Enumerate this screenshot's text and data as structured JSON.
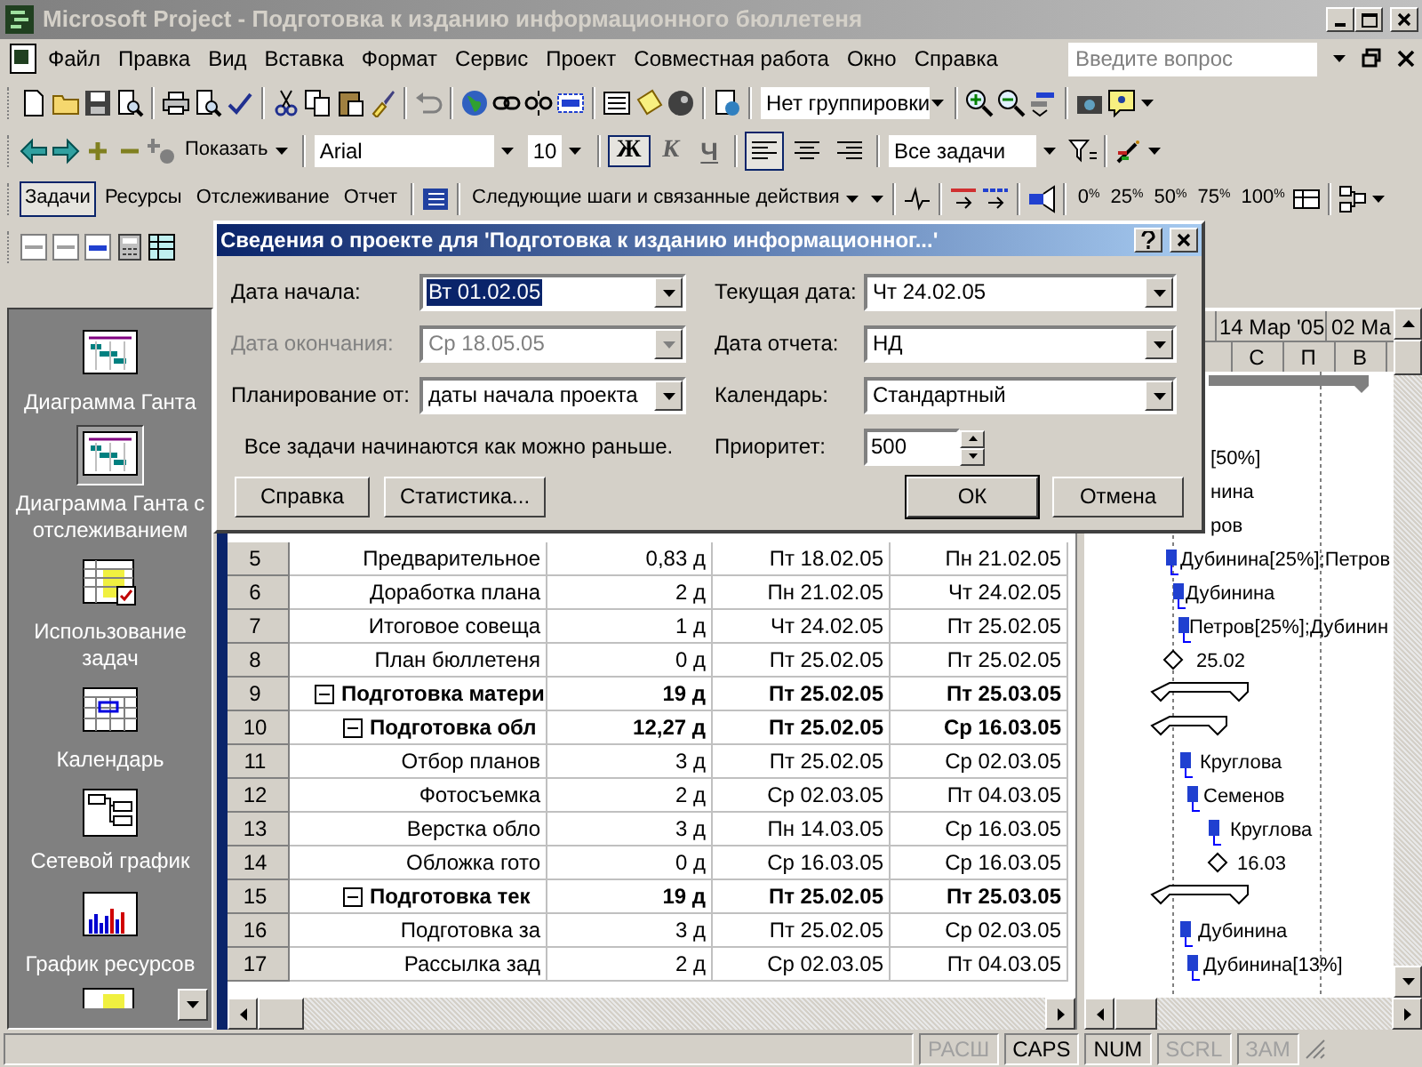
{
  "window": {
    "title": "Microsoft Project - Подготовка к изданию информационного бюллетеня"
  },
  "menu": [
    "Файл",
    "Правка",
    "Вид",
    "Вставка",
    "Формат",
    "Сервис",
    "Проект",
    "Совместная работа",
    "Окно",
    "Справка"
  ],
  "help_box": {
    "placeholder": "Введите вопрос"
  },
  "standard_toolbar": {
    "grouping": "Нет группировки"
  },
  "formatting_toolbar": {
    "show": "Показать",
    "font": "Arial",
    "size": "10",
    "styles": [
      {
        "label": "Ж",
        "on": true
      },
      {
        "label": "К",
        "on": false
      },
      {
        "label": "Ч",
        "on": false
      }
    ],
    "align": [
      {
        "selected": true
      },
      {
        "selected": false
      },
      {
        "selected": false
      }
    ],
    "filter": "Все задачи"
  },
  "guide_toolbar": {
    "tabs": [
      {
        "label": "Задачи",
        "selected": true
      },
      {
        "label": "Ресурсы",
        "selected": false
      },
      {
        "label": "Отслеживание",
        "selected": false
      },
      {
        "label": "Отчет",
        "selected": false
      }
    ],
    "next_steps": "Следующие шаги и связанные действия",
    "percent_buttons": [
      "0$^{%}$",
      "25$^{%}$",
      "50$^{%}$",
      "75$^{%}$",
      "100$^{%}$"
    ]
  },
  "view_bar": {
    "items": [
      {
        "label": "Диаграмма Ганта",
        "kind": "gantt",
        "selected": false
      },
      {
        "label": "Диаграмма Ганта с отслеживанием",
        "kind": "gantt",
        "selected": true
      },
      {
        "label": "Использование задач",
        "kind": "usage",
        "selected": false
      },
      {
        "label": "Календарь",
        "kind": "calendar",
        "selected": false
      },
      {
        "label": "Сетевой график",
        "kind": "network",
        "selected": false
      },
      {
        "label": "График ресурсов",
        "kind": "graph",
        "selected": false
      }
    ]
  },
  "table": {
    "rows": [
      {
        "id": "5",
        "name": "Предварительное",
        "duration": "0,83 д",
        "start": "Пт 18.02.05",
        "finish": "Пн 21.02.05",
        "summary": false
      },
      {
        "id": "6",
        "name": "Доработка плана",
        "duration": "2 д",
        "start": "Пн 21.02.05",
        "finish": "Чт 24.02.05",
        "summary": false
      },
      {
        "id": "7",
        "name": "Итоговое совеща",
        "duration": "1 д",
        "start": "Чт 24.02.05",
        "finish": "Пт 25.02.05",
        "summary": false
      },
      {
        "id": "8",
        "name": "План бюллетеня",
        "duration": "0 д",
        "start": "Пт 25.02.05",
        "finish": "Пт 25.02.05",
        "summary": false
      },
      {
        "id": "9",
        "name": "Подготовка матери",
        "duration": "19 д",
        "start": "Пт 25.02.05",
        "finish": "Пт 25.03.05",
        "summary": true,
        "expanded": true,
        "children": [
          {
            "id": "10",
            "name": "Подготовка обл",
            "duration": "12,27 д",
            "start": "Пт 25.02.05",
            "finish": "Ср 16.03.05",
            "summary": true,
            "expanded": true,
            "children": [
              {
                "id": "11",
                "name": "Отбор планов",
                "duration": "3 д",
                "start": "Пт 25.02.05",
                "finish": "Ср 02.03.05",
                "summary": false
              },
              {
                "id": "12",
                "name": "Фотосъемка",
                "duration": "2 д",
                "start": "Ср 02.03.05",
                "finish": "Пт 04.03.05",
                "summary": false
              },
              {
                "id": "13",
                "name": "Верстка обло",
                "duration": "3 д",
                "start": "Пн 14.03.05",
                "finish": "Ср 16.03.05",
                "summary": false
              },
              {
                "id": "14",
                "name": "Обложка гото",
                "duration": "0 д",
                "start": "Ср 16.03.05",
                "finish": "Ср 16.03.05",
                "summary": false
              }
            ]
          },
          {
            "id": "15",
            "name": "Подготовка тек",
            "duration": "19 д",
            "start": "Пт 25.02.05",
            "finish": "Пт 25.03.05",
            "summary": true,
            "expanded": true,
            "children": [
              {
                "id": "16",
                "name": "Подготовка за",
                "duration": "3 д",
                "start": "Пт 25.02.05",
                "finish": "Ср 02.03.05",
                "summary": false
              },
              {
                "id": "17",
                "name": "Рассылка зад",
                "duration": "2 д",
                "start": "Ср 02.03.05",
                "finish": "Пт 04.03.05",
                "summary": false
              }
            ]
          }
        ]
      }
    ]
  },
  "gantt": {
    "timescale_top": [
      "14 Мар '05",
      "02 Ма"
    ],
    "timescale_bottom": [
      "С",
      "П",
      "В"
    ],
    "bars": [
      {
        "kind": "label",
        "label": "[50%]"
      },
      {
        "kind": "label",
        "label": "нина"
      },
      {
        "kind": "label",
        "label": "ров"
      },
      {
        "kind": "task",
        "label": "Дубинина[25%];Петров"
      },
      {
        "kind": "task",
        "label": "Дубинина"
      },
      {
        "kind": "task",
        "label": "Петров[25%];Дубинин"
      },
      {
        "kind": "milestone",
        "label": "25.02"
      },
      {
        "kind": "summary"
      },
      {
        "kind": "summary"
      },
      {
        "kind": "task",
        "label": "Круглова"
      },
      {
        "kind": "task",
        "label": "Семенов"
      },
      {
        "kind": "task",
        "label": "Круглова"
      },
      {
        "kind": "milestone",
        "label": "16.03"
      },
      {
        "kind": "summary"
      },
      {
        "kind": "task",
        "label": "Дубинина"
      },
      {
        "kind": "task",
        "label": "Дубинина[13%]"
      }
    ]
  },
  "dialog": {
    "title": "Сведения о проекте для 'Подготовка к изданию информационног...'",
    "left_fields": [
      {
        "label": "Дата начала:",
        "value": "Вт 01.02.05",
        "highlighted": true,
        "disabled": false
      },
      {
        "label": "Дата окончания:",
        "value": "Ср 18.05.05",
        "highlighted": false,
        "disabled": true
      },
      {
        "label": "Планирование от:",
        "value": "даты начала проекта",
        "highlighted": false,
        "disabled": false
      }
    ],
    "note": "Все задачи начинаются как можно раньше.",
    "right_fields": [
      {
        "label": "Текущая дата:",
        "value": "Чт 24.02.05",
        "kind": "combo"
      },
      {
        "label": "Дата отчета:",
        "value": "НД",
        "kind": "combo"
      },
      {
        "label": "Календарь:",
        "value": "Стандартный",
        "kind": "combo"
      },
      {
        "label": "Приоритет:",
        "value": "500",
        "kind": "spin"
      }
    ],
    "buttons": [
      {
        "label": "Справка",
        "default": false
      },
      {
        "label": "Статистика...",
        "default": false
      },
      {
        "label": "ОК",
        "default": true
      },
      {
        "label": "Отмена",
        "default": false
      }
    ]
  },
  "status_bar": [
    {
      "label": "РАСШ",
      "active": false
    },
    {
      "label": "CAPS",
      "active": true
    },
    {
      "label": "NUM",
      "active": true
    },
    {
      "label": "SCRL",
      "active": false
    },
    {
      "label": "ЗАМ",
      "active": false
    }
  ]
}
